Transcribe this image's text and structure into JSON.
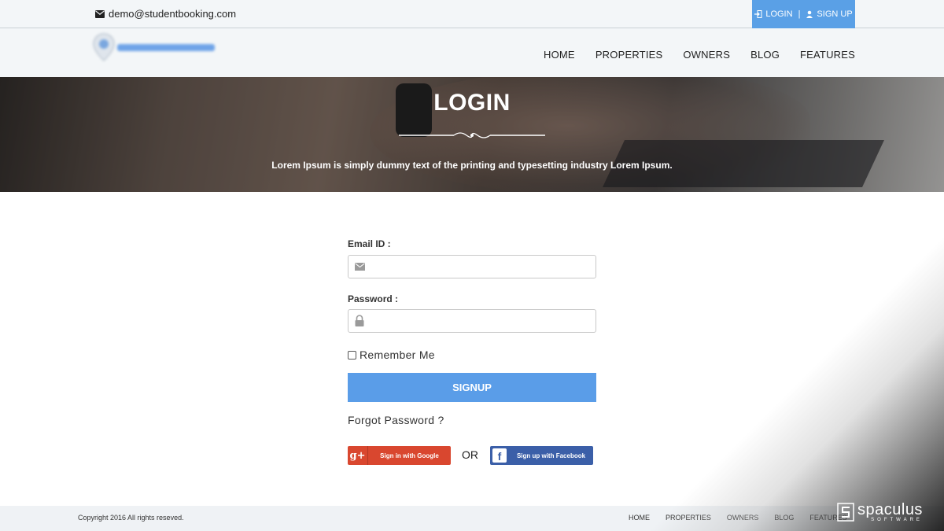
{
  "topbar": {
    "email": "demo@studentbooking.com",
    "login_label": "LOGIN",
    "separator": "|",
    "signup_label": "SIGN UP"
  },
  "nav": {
    "items": [
      "HOME",
      "PROPERTIES",
      "OWNERS",
      "BLOG",
      "FEATURES"
    ]
  },
  "hero": {
    "title": "LOGIN",
    "subtitle": "Lorem Ipsum is simply dummy text of the printing and typesetting industry Lorem Ipsum."
  },
  "form": {
    "email_label": "Email ID :",
    "email_value": "",
    "email_icon": "envelope-icon",
    "password_label": "Password :",
    "password_value": "",
    "password_icon": "lock-icon",
    "remember_label": "Remember Me",
    "remember_checked": false,
    "submit_label": "SIGNUP",
    "forgot_label": "Forgot Password ?",
    "google_label": "Sign in with Google",
    "or_label": "OR",
    "facebook_label": "Sign up with Facebook"
  },
  "footer": {
    "copyright": "Copyright 2016 All rights reseved.",
    "links": [
      "HOME",
      "PROPERTIES",
      "OWNERS",
      "BLOG",
      "FEATURES"
    ]
  },
  "brand": {
    "name": "spaculus",
    "tagline": "SOFTWARE"
  },
  "colors": {
    "accent": "#5a9de8",
    "google": "#d9472f",
    "facebook": "#3b5fa8",
    "topbar_bg": "#f3f6f8"
  }
}
